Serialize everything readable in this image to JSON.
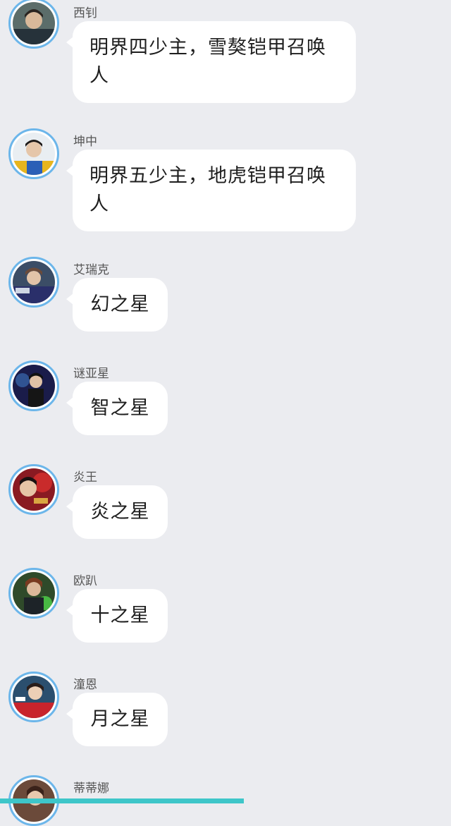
{
  "messages": [
    {
      "sender": "西钊",
      "text": "明界四少主，雪獒铠甲召唤人"
    },
    {
      "sender": "坤中",
      "text": "明界五少主，地虎铠甲召唤人"
    },
    {
      "sender": "艾瑞克",
      "text": "幻之星"
    },
    {
      "sender": "谜亚星",
      "text": "智之星"
    },
    {
      "sender": "炎王",
      "text": "炎之星"
    },
    {
      "sender": "欧趴",
      "text": "十之星"
    },
    {
      "sender": "潼恩",
      "text": "月之星"
    },
    {
      "sender": "蒂蒂娜",
      "text": ""
    }
  ],
  "colors": {
    "background": "#ebecf0",
    "bubble": "#ffffff",
    "avatar_ring": "#6cb6ea",
    "progress": "#3ec6c9"
  },
  "progress": {
    "fraction": 0.54
  }
}
